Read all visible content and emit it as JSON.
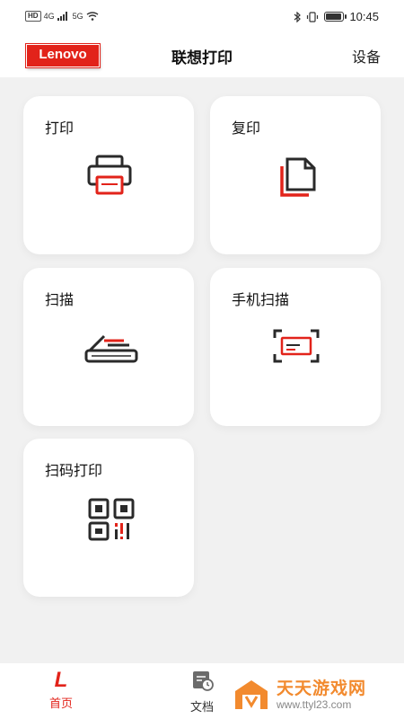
{
  "status_bar": {
    "left_indicators": [
      "HD",
      "4G",
      "5G"
    ],
    "time": "10:45",
    "battery_level": 0.85
  },
  "header": {
    "logo": "Lenovo",
    "title": "联想打印",
    "device_label": "设备"
  },
  "tiles": [
    {
      "label": "打印",
      "icon": "printer-icon"
    },
    {
      "label": "复印",
      "icon": "copy-icon"
    },
    {
      "label": "扫描",
      "icon": "scanner-icon"
    },
    {
      "label": "手机扫描",
      "icon": "phone-scan-icon"
    },
    {
      "label": "扫码打印",
      "icon": "qr-code-icon"
    }
  ],
  "bottom_nav": {
    "home_label": "首页",
    "docs_label": "文档"
  },
  "watermark": {
    "title": "天天游戏网",
    "url": "www.ttyl23.com"
  },
  "colors": {
    "accent": "#e2231a",
    "icon_dark": "#2a2a2a",
    "background": "#f1f1f1",
    "watermark": "#f28a2e"
  }
}
